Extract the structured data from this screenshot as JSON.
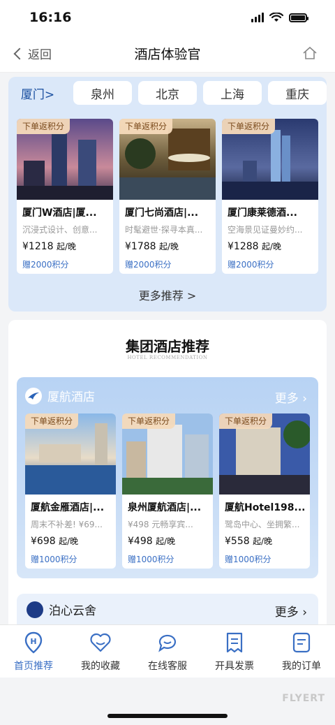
{
  "status": {
    "time": "16:16"
  },
  "nav": {
    "back_label": "返回",
    "title": "酒店体验官"
  },
  "cities": [
    "厦门>",
    "泉州",
    "北京",
    "上海",
    "重庆"
  ],
  "city_hotels": [
    {
      "tag": "下单返积分",
      "name": "厦门W酒店|厦...",
      "desc": "沉浸式设计、创意...",
      "price": "¥1218",
      "unit": "起/晚",
      "points": "赠2000积分"
    },
    {
      "tag": "下单返积分",
      "name": "厦门七尚酒店|...",
      "desc": "时髦避世·探寻本真...",
      "price": "¥1788",
      "unit": "起/晚",
      "points": "赠2000积分"
    },
    {
      "tag": "下单返积分",
      "name": "厦门康莱德酒...",
      "desc": "空海景见证曼妙约...",
      "price": "¥1288",
      "unit": "起/晚",
      "points": "赠2000积分"
    }
  ],
  "more_recommend": "更多推荐 >",
  "group": {
    "title": "集团酒店推荐",
    "subtitle": "HOTEL RECOMMENDATION"
  },
  "brand1": {
    "name": "厦航酒店",
    "more": "更多 ›",
    "hotels": [
      {
        "tag": "下单返积分",
        "name": "厦航金雁酒店|...",
        "desc": "周末不补差! ¥69...",
        "price": "¥698",
        "unit": "起/晚",
        "points": "赠1000积分"
      },
      {
        "tag": "下单返积分",
        "name": "泉州厦航酒店|...",
        "desc": "¥498 元畅享宾...",
        "price": "¥498",
        "unit": "起/晚",
        "points": "赠1000积分"
      },
      {
        "tag": "下单返积分",
        "name": "厦航Hotel198...",
        "desc": "鹭岛中心、坐拥繁...",
        "price": "¥558",
        "unit": "起/晚",
        "points": "赠1000积分"
      }
    ]
  },
  "brand2": {
    "name": "泊心云舍",
    "more": "更多 ›"
  },
  "tabbar": [
    {
      "label": "首页推荐",
      "icon": "home-h-icon"
    },
    {
      "label": "我的收藏",
      "icon": "heart-icon"
    },
    {
      "label": "在线客服",
      "icon": "chat-icon"
    },
    {
      "label": "开具发票",
      "icon": "invoice-icon"
    },
    {
      "label": "我的订单",
      "icon": "order-icon"
    }
  ],
  "watermark": "FLYERT",
  "colors": {
    "accent": "#3a6fc4",
    "tag_bg": "#f5dab9",
    "panel_bg": "#dbe8f9"
  }
}
